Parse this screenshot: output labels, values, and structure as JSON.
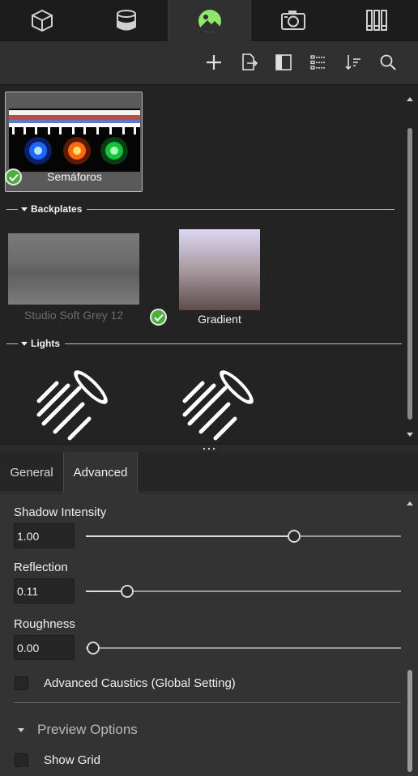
{
  "top_tabs": [
    {
      "name": "models",
      "icon": "cube-icon"
    },
    {
      "name": "materials",
      "icon": "bucket-icon"
    },
    {
      "name": "environments",
      "icon": "landscape-icon"
    },
    {
      "name": "cameras",
      "icon": "camera-icon"
    },
    {
      "name": "libraries",
      "icon": "book-columns-icon"
    }
  ],
  "active_top_tab": "environments",
  "toolbar": {
    "icons": [
      "add-icon",
      "import-icon",
      "split-view-icon",
      "list-view-icon",
      "sort-icon",
      "search-icon"
    ]
  },
  "library": {
    "selected_environment": {
      "label": "Semáforos",
      "active": true
    },
    "sections": [
      {
        "title": "Backplates",
        "items": [
          {
            "label": "Studio Soft Grey 12",
            "dimmed": true
          },
          {
            "label": "Gradient",
            "active": true
          }
        ]
      },
      {
        "title": "Lights",
        "items": [
          {
            "icon": "spotlight-icon"
          },
          {
            "icon": "spotlight-icon"
          }
        ]
      }
    ]
  },
  "prop_tabs": [
    "General",
    "Advanced"
  ],
  "active_prop_tab": "Advanced",
  "properties": {
    "shadow_intensity": {
      "label": "Shadow Intensity",
      "value": "1.00",
      "slider_fraction": 0.66
    },
    "reflection": {
      "label": "Reflection",
      "value": "0.11",
      "slider_fraction": 0.13
    },
    "roughness": {
      "label": "Roughness",
      "value": "0.00",
      "slider_fraction": 0.0
    },
    "advanced_caustics": {
      "label": "Advanced Caustics (Global Setting)",
      "checked": false
    },
    "preview_options": {
      "title": "Preview Options"
    },
    "show_grid": {
      "label": "Show Grid",
      "checked": false
    }
  },
  "colors": {
    "accent_green": "#4caf3b",
    "active_icon_green": "#8ee66a"
  }
}
